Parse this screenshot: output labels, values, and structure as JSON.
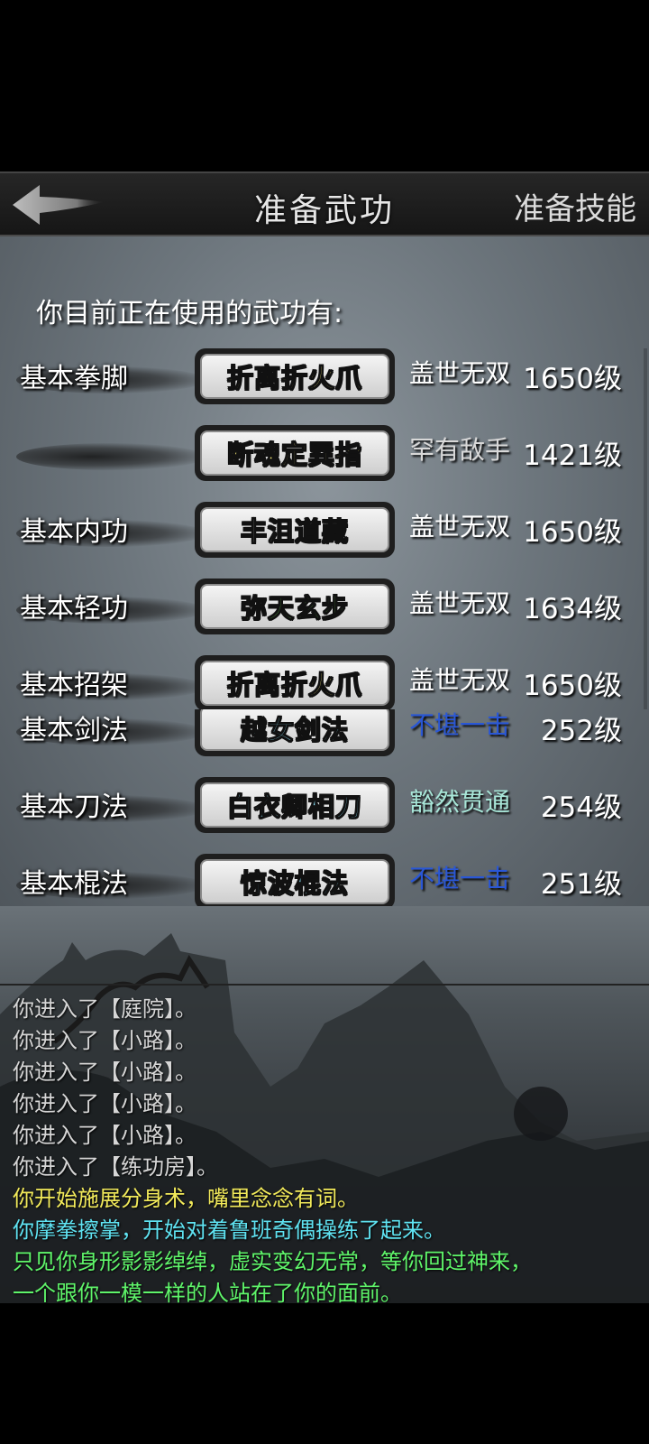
{
  "header": {
    "title": "准备武功",
    "right_button": "准备技能"
  },
  "panel": {
    "section_title": "你目前正在使用的武功有:",
    "rows": [
      {
        "type": "基本拳脚",
        "skill": "折离折火爪",
        "skill_color": "#fff27a",
        "rank": "盖世无双",
        "rank_color": "#ffffff",
        "level": "1650级"
      },
      {
        "type": "",
        "skill": "断魂定巽指",
        "skill_color": "#fff27a",
        "rank": "罕有敌手",
        "rank_color": "#d8d8d8",
        "level": "1421级"
      },
      {
        "type": "基本内功",
        "skill": "丰沮道藏",
        "skill_color": "#ffffff",
        "rank": "盖世无双",
        "rank_color": "#ffffff",
        "level": "1650级"
      },
      {
        "type": "基本轻功",
        "skill": "弥天玄步",
        "skill_color": "#7dff5a",
        "rank": "盖世无双",
        "rank_color": "#ffffff",
        "level": "1634级"
      },
      {
        "type": "基本招架",
        "skill": "折离折火爪",
        "skill_color": "#fff27a",
        "rank": "盖世无双",
        "rank_color": "#ffffff",
        "level": "1650级"
      },
      {
        "type": "基本剑法",
        "skill": "越女剑法",
        "skill_color": "#8fe8ff",
        "rank": "不堪一击",
        "rank_color": "#2a57d6",
        "level": "252级"
      },
      {
        "type": "基本刀法",
        "skill": "白衣卿相刀",
        "skill_color": "#8fe8ff",
        "rank": "豁然贯通",
        "rank_color": "#a8e6d8",
        "level": "254级"
      },
      {
        "type": "基本棍法",
        "skill": "惊波棍法",
        "skill_color": "#8fe8ff",
        "rank": "不堪一击",
        "rank_color": "#2a57d6",
        "level": "251级"
      }
    ]
  },
  "log": {
    "lines": [
      {
        "text": "你进入了【庭院】。",
        "color": "#d6d6d6"
      },
      {
        "text": "你进入了【小路】。",
        "color": "#d6d6d6"
      },
      {
        "text": "你进入了【小路】。",
        "color": "#d6d6d6"
      },
      {
        "text": "你进入了【小路】。",
        "color": "#d6d6d6"
      },
      {
        "text": "你进入了【小路】。",
        "color": "#d6d6d6"
      },
      {
        "text": "你进入了【练功房】。",
        "color": "#d6d6d6"
      },
      {
        "text": "你开始施展分身术，嘴里念念有词。",
        "color": "#f2ea5a"
      },
      {
        "text": "你摩拳擦掌，开始对着鲁班奇偶操练了起来。",
        "color": "#5fe3f2"
      },
      {
        "text": "只见你身形影影绰绰，虚实变幻无常，等你回过神来，",
        "color": "#5ff56a"
      },
      {
        "text": "一个跟你一模一样的人站在了你的面前。",
        "color": "#5ff56a"
      }
    ]
  }
}
